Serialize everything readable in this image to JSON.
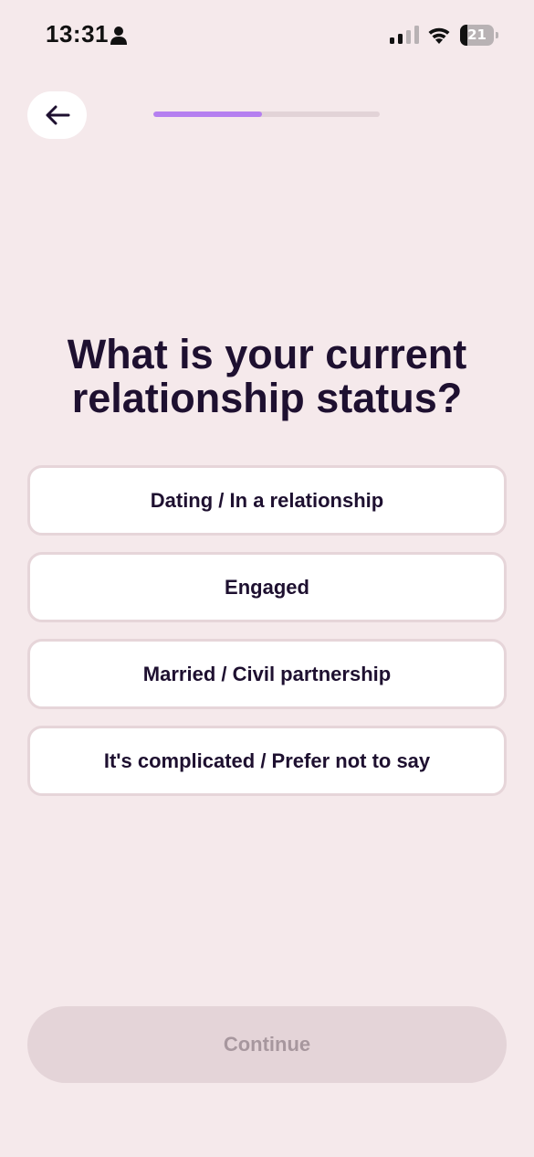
{
  "status_bar": {
    "time": "13:31",
    "battery_level": "21",
    "battery_fraction": 0.21
  },
  "icons": {
    "person": "person-icon",
    "signal": "cellular-signal-icon",
    "wifi": "wifi-icon",
    "battery": "battery-icon",
    "back": "arrow-left-icon"
  },
  "progress": {
    "fraction": 0.48
  },
  "question": {
    "title": "What is your current relationship status?"
  },
  "options": [
    {
      "label": "Dating / In a relationship"
    },
    {
      "label": "Engaged"
    },
    {
      "label": "Married / Civil partnership"
    },
    {
      "label": "It's complicated / Prefer not to say"
    }
  ],
  "continue_button": {
    "label": "Continue",
    "enabled": false
  },
  "colors": {
    "background": "#f5e9eb",
    "accent": "#b57ff0",
    "text": "#1e1030",
    "disabled_button": "#e4d4d8",
    "disabled_text": "#a7979e"
  }
}
